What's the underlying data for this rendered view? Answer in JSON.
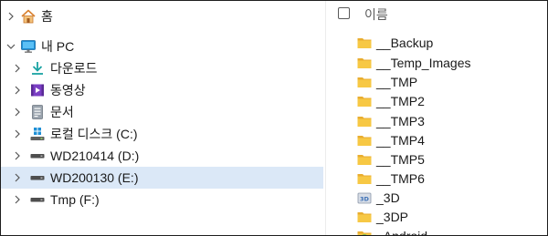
{
  "nav": {
    "home": {
      "label": "홈"
    },
    "this_pc": {
      "label": "내 PC"
    },
    "items": [
      {
        "label": "다운로드",
        "icon": "download-icon"
      },
      {
        "label": "동영상",
        "icon": "videos-icon"
      },
      {
        "label": "문서",
        "icon": "documents-icon"
      },
      {
        "label": "로컬 디스크 (C:)",
        "icon": "windows-drive-icon"
      },
      {
        "label": "WD210414 (D:)",
        "icon": "drive-icon"
      },
      {
        "label": "WD200130 (E:)",
        "icon": "drive-icon",
        "selected": true
      },
      {
        "label": "Tmp (F:)",
        "icon": "drive-icon"
      }
    ]
  },
  "content": {
    "column_header": "이름",
    "files": [
      {
        "name": "__Backup",
        "icon": "folder-icon"
      },
      {
        "name": "__Temp_Images",
        "icon": "folder-icon"
      },
      {
        "name": "__TMP",
        "icon": "folder-icon"
      },
      {
        "name": "__TMP2",
        "icon": "folder-icon"
      },
      {
        "name": "__TMP3",
        "icon": "folder-icon"
      },
      {
        "name": "__TMP4",
        "icon": "folder-icon"
      },
      {
        "name": "__TMP5",
        "icon": "folder-icon"
      },
      {
        "name": "__TMP6",
        "icon": "folder-icon"
      },
      {
        "name": "_3D",
        "icon": "3d-objects-folder-icon"
      },
      {
        "name": "_3DP",
        "icon": "folder-icon"
      },
      {
        "name": "_Android",
        "icon": "android-folder-icon"
      }
    ]
  },
  "colors": {
    "selected_row": "#dbe8f7",
    "folder": "#f7c844",
    "download_accent": "#1aa3a3",
    "monitor": "#1e8fd6"
  }
}
